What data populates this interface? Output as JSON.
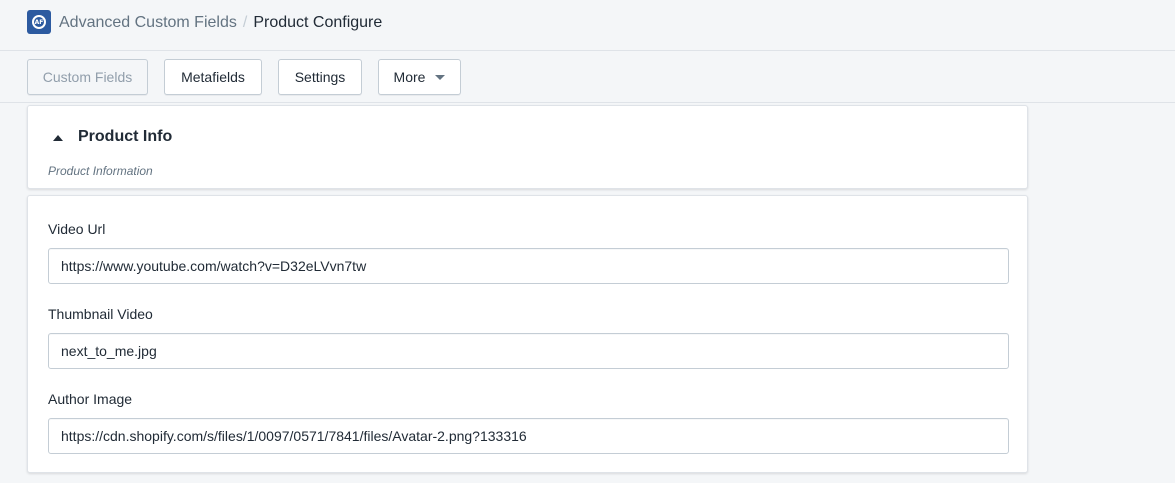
{
  "header": {
    "app_logo_icon": "acf-logo-icon",
    "app_name": "Advanced Custom Fields",
    "separator": "/",
    "page_title": "Product Configure"
  },
  "toolbar": {
    "custom_fields_label": "Custom Fields",
    "metafields_label": "Metafields",
    "settings_label": "Settings",
    "more_label": "More",
    "more_icon": "caret-down-icon"
  },
  "section": {
    "title": "Product Info",
    "description": "Product Information",
    "toggle_icon": "caret-up-icon"
  },
  "fields": [
    {
      "label": "Video Url",
      "value": "https://www.youtube.com/watch?v=D32eLVvn7tw"
    },
    {
      "label": "Thumbnail Video",
      "value": "next_to_me.jpg"
    },
    {
      "label": "Author Image",
      "value": "https://cdn.shopify.com/s/files/1/0097/0571/7841/files/Avatar-2.png?133316"
    }
  ],
  "colors": {
    "background": "#f4f6f8",
    "card": "#ffffff",
    "border": "#c4cdd5",
    "text": "#212b36",
    "muted": "#637381",
    "logo": "#2c5aa0"
  }
}
